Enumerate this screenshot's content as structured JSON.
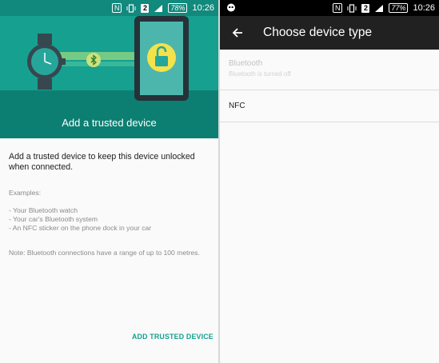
{
  "left": {
    "statusbar": {
      "time": "10:26",
      "battery": "78%",
      "sim_badge": "2",
      "nfc": "N"
    },
    "hero": {
      "title": "Add a trusted device"
    },
    "description": "Add a trusted device to keep this device unlocked when connected.",
    "examples_heading": "Examples:",
    "examples": [
      "- Your Bluetooth watch",
      "- Your car's Bluetooth system",
      "- An NFC sticker on the phone dock in your car"
    ],
    "note": "Note: Bluetooth connections have a range of up to 100 metres.",
    "add_button": "ADD TRUSTED DEVICE",
    "colors": {
      "accent": "#16a08f",
      "hero": "#15a08f",
      "hero_dark": "#0d7f72"
    }
  },
  "right": {
    "statusbar": {
      "time": "10:26",
      "battery": "77%",
      "sim_badge": "2",
      "nfc": "N"
    },
    "toolbar": {
      "title": "Choose device type"
    },
    "options": [
      {
        "title": "Bluetooth",
        "subtitle": "Bluetooth is turned off",
        "enabled": false
      },
      {
        "title": "NFC",
        "subtitle": "",
        "enabled": true
      }
    ],
    "colors": {
      "toolbar": "#212121"
    }
  }
}
